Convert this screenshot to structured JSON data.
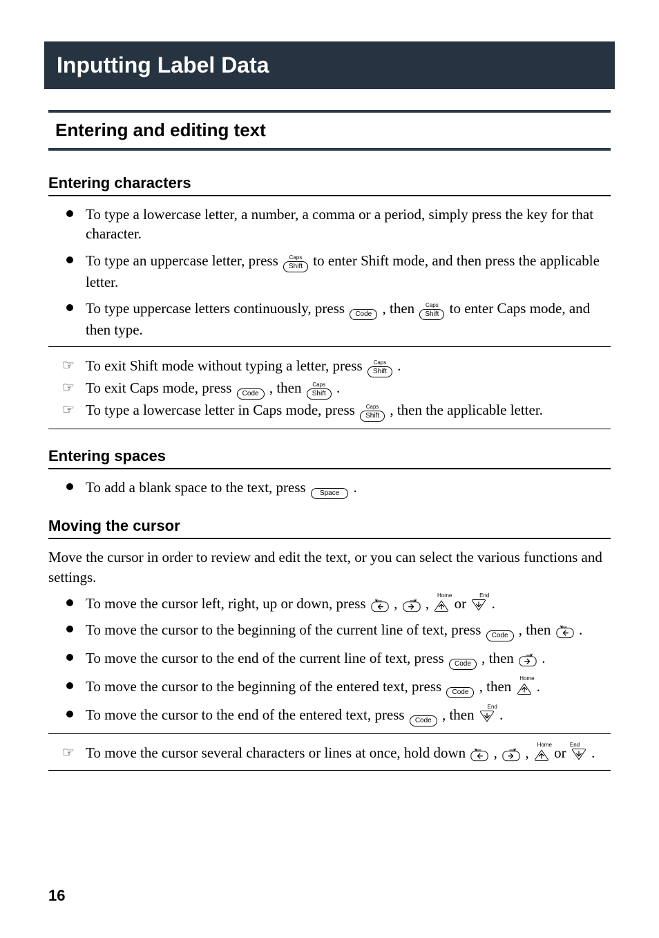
{
  "page_number": "16",
  "headings": {
    "h1": "Inputting Label Data",
    "h2": "Entering and editing text",
    "h3_chars": "Entering characters",
    "h3_spaces": "Entering spaces",
    "h3_cursor": "Moving the cursor"
  },
  "keys": {
    "shift": "Shift",
    "shift_sup": "Caps",
    "code": "Code",
    "space": "Space",
    "home_sup": "Home",
    "end_sup": "End"
  },
  "entering_characters": {
    "b1": "To type a lowercase letter, a number, a comma or a period, simply press the key for that character.",
    "b2_a": "To type an uppercase letter, press ",
    "b2_b": " to enter Shift mode, and then press the applicable letter.",
    "b3_a": "To type uppercase letters continuously, press ",
    "b3_b": ", then ",
    "b3_c": " to enter Caps mode, and then type."
  },
  "entering_characters_notes": {
    "n1_a": "To exit Shift mode without typing a letter, press ",
    "n1_b": ".",
    "n2_a": "To exit Caps mode, press ",
    "n2_b": ", then ",
    "n2_c": ".",
    "n3_a": "To type a lowercase letter in Caps mode, press ",
    "n3_b": ", then the applicable letter."
  },
  "entering_spaces": {
    "b1_a": "To add a blank space to the text, press ",
    "b1_b": "."
  },
  "moving_cursor": {
    "intro": "Move the cursor in order to review and edit the text, or you can select the various functions and settings.",
    "b1_a": "To move the cursor left, right, up or down, press ",
    "b1_b": ", ",
    "b1_c": ", ",
    "b1_d": " or ",
    "b1_e": ".",
    "b2_a": "To move the cursor to the beginning of the current line of text, press ",
    "b2_b": ", then ",
    "b2_c": ".",
    "b3_a": "To move the cursor to the end of the current line of text, press ",
    "b3_b": ", then ",
    "b3_c": ".",
    "b4_a": "To move the cursor to the beginning of the entered text, press ",
    "b4_b": ", then ",
    "b4_c": ".",
    "b5_a": "To move the cursor to the end of the entered text, press ",
    "b5_b": ", then ",
    "b5_c": "."
  },
  "moving_cursor_note": {
    "n1_a": "To move the cursor several characters or lines at once, hold down ",
    "n1_b": ", ",
    "n1_c": ", ",
    "n1_d": " or ",
    "n1_e": "."
  }
}
